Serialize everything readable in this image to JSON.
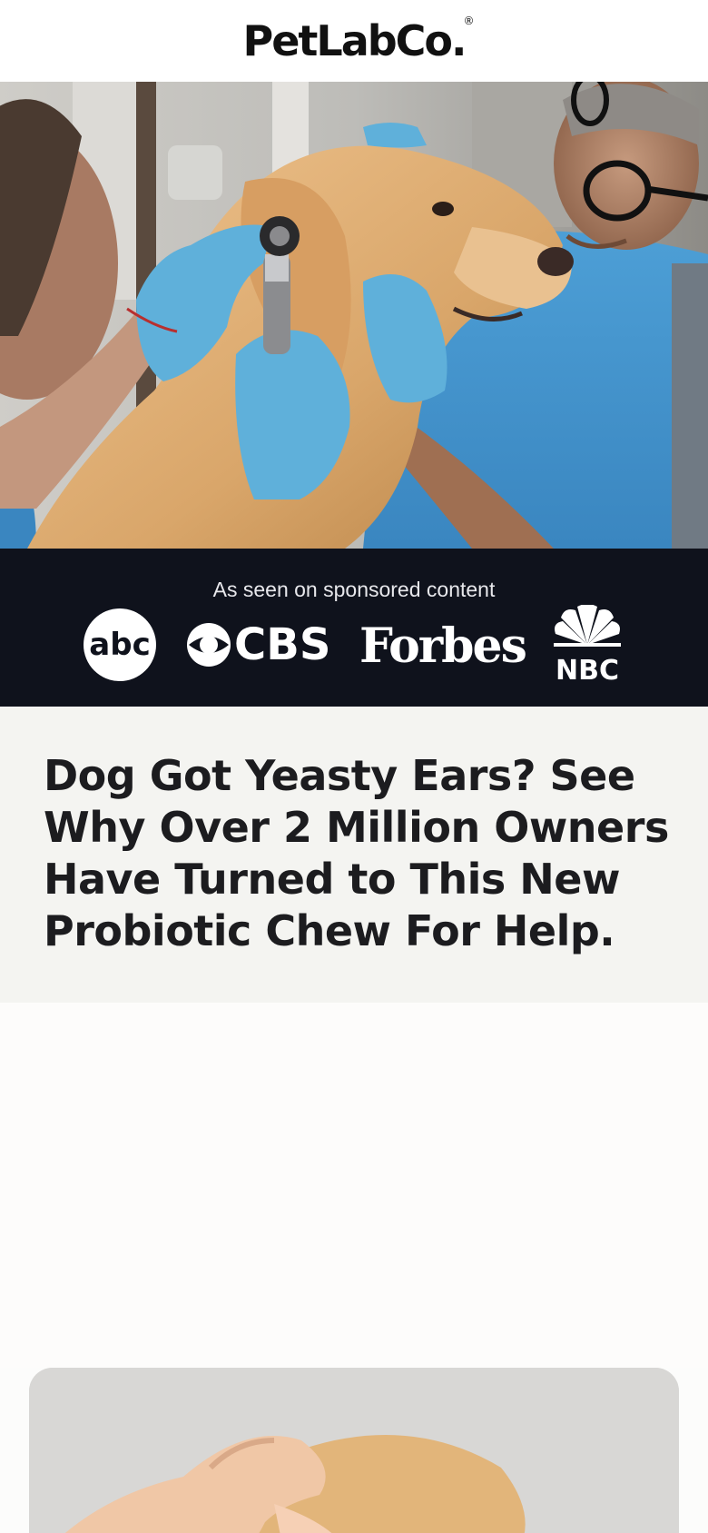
{
  "brand": {
    "name": "PetLabCo.",
    "registered": "®"
  },
  "hero": {
    "image": "veterinarian-examining-dog-ear"
  },
  "press": {
    "caption": "As seen on sponsored content",
    "logos": [
      "abc",
      "CBS",
      "Forbes",
      "NBC"
    ]
  },
  "headline": "Dog Got Yeasty Ears? See Why Over 2 Million Owners Have Turned to This New Probiotic Chew For Help.",
  "card": {
    "image": "hands-holding-dog-ear"
  },
  "colors": {
    "press_bg": "#0f121c",
    "headline_bg": "#f4f4f1",
    "glove": "#5fb0da"
  }
}
